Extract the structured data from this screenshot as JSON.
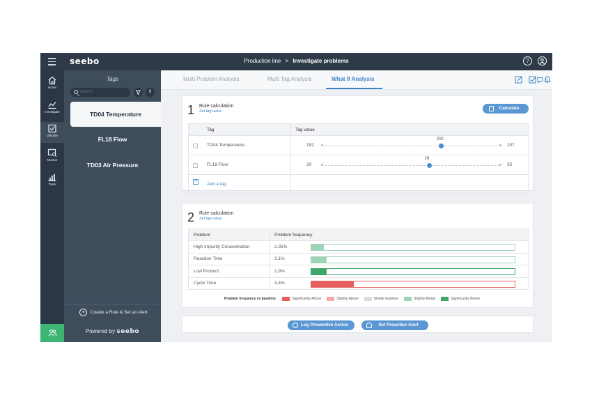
{
  "topbar": {
    "logo": "seebo",
    "breadcrumb_parent": "Production line",
    "breadcrumb_sep": ">",
    "breadcrumb_current": "Investigate problems",
    "help_icon": "question-circle-icon",
    "user_icon": "user-circle-icon"
  },
  "rail": {
    "items": [
      {
        "label": "Home",
        "icon": "home-icon"
      },
      {
        "label": "Investigate",
        "icon": "chart-line-icon"
      },
      {
        "label": "Validate",
        "icon": "checkbox-icon"
      },
      {
        "label": "Monitor",
        "icon": "monitor-icon"
      },
      {
        "label": "Track",
        "icon": "bar-chart-icon"
      }
    ],
    "active": "Validate"
  },
  "tags_panel": {
    "title": "Tags",
    "search_placeholder": "Search",
    "filter_count": "0",
    "items": [
      "TD04 Temperature",
      "FL18 Flow",
      "TD03 Air Pressure"
    ],
    "selected": "TD04 Temperature",
    "create_label": "Create a Rule & Set an Alert",
    "powered_prefix": "Powered by",
    "powered_brand": "seebo"
  },
  "tabs": {
    "items": [
      "Multi Problem Analysis",
      "Multi Tag Analysis",
      "What If Analysis"
    ],
    "active": "What If Analysis",
    "comment_count": "2",
    "accent": "#3f84c8"
  },
  "card1": {
    "number": "1",
    "title": "Rule calculation",
    "subtitle": "Set tag value",
    "calculate_label": "Calculate",
    "col_tag": "Tag",
    "col_value": "Tag value",
    "rows": [
      {
        "tag": "TD04 Temperature",
        "min": "192",
        "max": "207",
        "value": "202",
        "fraction": 0.667
      },
      {
        "tag": "FL18 Flow",
        "min": "20",
        "max": "35",
        "value": "29",
        "fraction": 0.6
      }
    ],
    "add_tag_label": "Add a tag"
  },
  "card2": {
    "number": "2",
    "title": "Rule calculation",
    "subtitle": "Set tag value",
    "col_problem": "Problem",
    "col_frequency": "Problem frequency",
    "rows": [
      {
        "problem": "High Impurity Concentration",
        "value": "2.35%",
        "fraction": 0.06,
        "status": "slightly_below"
      },
      {
        "problem": "Reaction Time",
        "value": "3.1%",
        "fraction": 0.075,
        "status": "slightly_below"
      },
      {
        "problem": "Low Product",
        "value": "1.9%",
        "fraction": 0.075,
        "status": "significantly_below"
      },
      {
        "problem": "Cycle Time",
        "value": "3.4%",
        "fraction": 0.21,
        "status": "significantly_above"
      }
    ],
    "legend_title": "Problem frequency vs baseline:",
    "legend": [
      {
        "label": "Significantly Above",
        "color": "#e8605d"
      },
      {
        "label": "Slightly Above",
        "color": "#f0a9a6"
      },
      {
        "label": "Similar baseline",
        "color": "#dcdcdc"
      },
      {
        "label": "Slightly Below",
        "color": "#9fd3b8"
      },
      {
        "label": "Significantly Below",
        "color": "#3fa66a"
      }
    ]
  },
  "actions": {
    "log_label": "Log Preventive Action",
    "alert_label": "Set Proactive Alert"
  },
  "colors": {
    "significantly_above": "#e8605d",
    "slightly_above": "#f0a9a6",
    "similar": "#dcdcdc",
    "slightly_below": "#9fd3b8",
    "significantly_below": "#3fa66a",
    "topbar": "#2e3a47",
    "sidebar": "#3e4c5c",
    "accent": "#3f84c8"
  }
}
